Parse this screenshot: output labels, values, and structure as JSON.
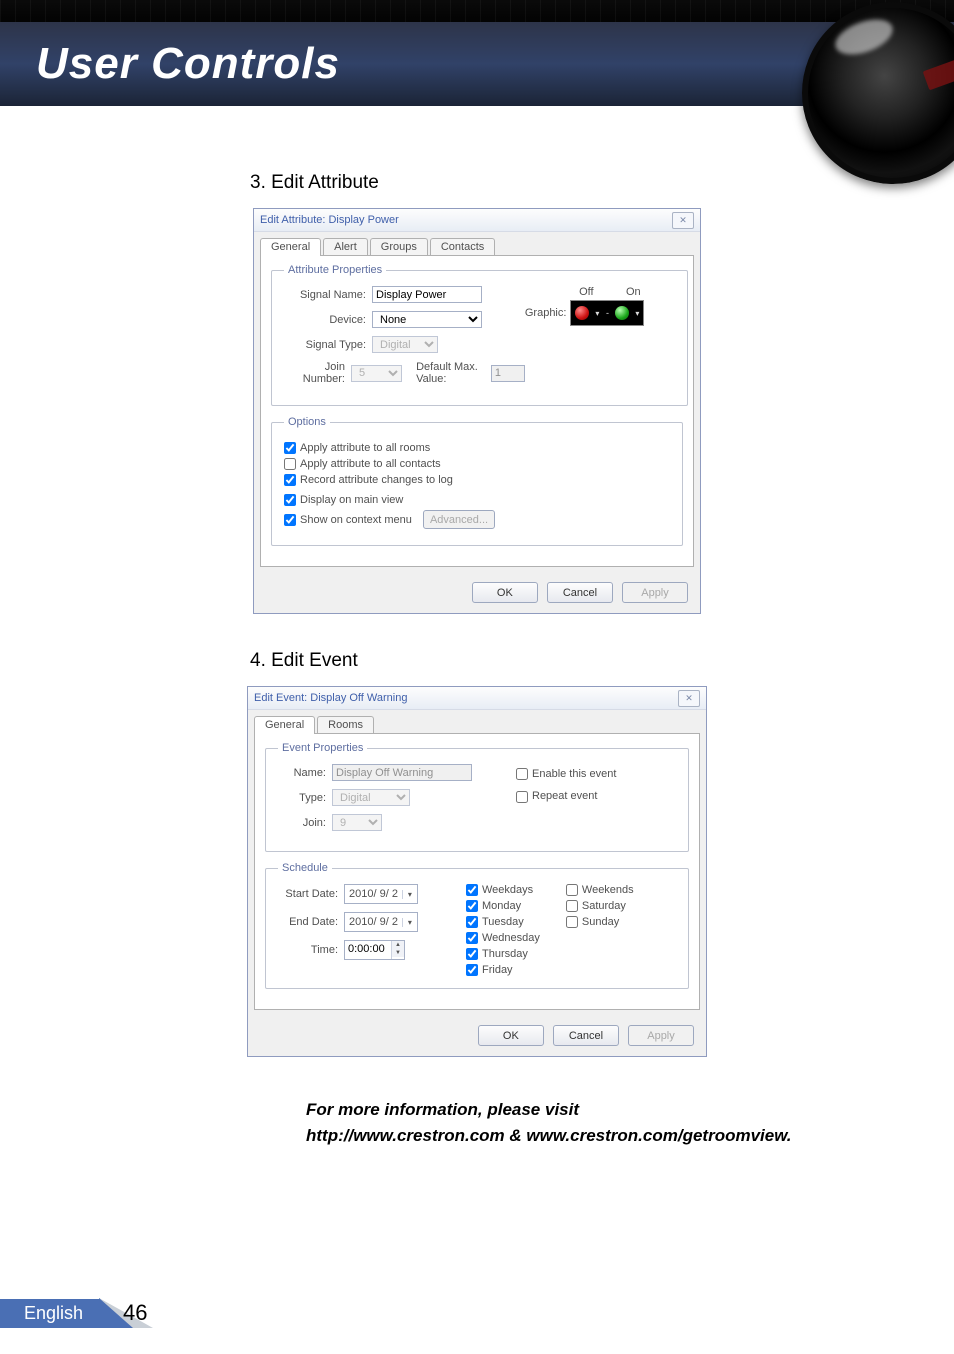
{
  "page": {
    "title": "User Controls",
    "step3": "3.   Edit Attribute",
    "step4": "4.   Edit Event",
    "info_line1": "For more information, please visit",
    "info_line2": "http://www.crestron.com & www.crestron.com/getroomview.",
    "footer_lang": "English",
    "footer_page": "46"
  },
  "dialog1": {
    "title": "Edit Attribute: Display Power",
    "tabs": [
      "General",
      "Alert",
      "Groups",
      "Contacts"
    ],
    "fs_props": "Attribute Properties",
    "signal_name_label": "Signal Name:",
    "signal_name_value": "Display Power",
    "device_label": "Device:",
    "device_value": "None",
    "signal_type_label": "Signal Type:",
    "signal_type_value": "Digital",
    "join_label": "Join Number:",
    "join_value": "5",
    "default_max_label": "Default Max. Value:",
    "default_max_value": "1",
    "graphic_label": "Graphic:",
    "graphic_off": "Off",
    "graphic_on": "On",
    "fs_options": "Options",
    "opt_all_rooms": "Apply attribute to all rooms",
    "opt_all_contacts": "Apply attribute to all contacts",
    "opt_record_log": "Record attribute changes to log",
    "opt_main_view": "Display on main view",
    "opt_context_menu": "Show on context menu",
    "advanced_btn": "Advanced...",
    "ok": "OK",
    "cancel": "Cancel",
    "apply": "Apply"
  },
  "dialog2": {
    "title": "Edit Event: Display Off Warning",
    "tabs": [
      "General",
      "Rooms"
    ],
    "fs_props": "Event Properties",
    "name_label": "Name:",
    "name_value": "Display Off Warning",
    "type_label": "Type:",
    "type_value": "Digital",
    "join_label": "Join:",
    "join_value": "9",
    "enable_event": "Enable this event",
    "repeat_event": "Repeat event",
    "fs_schedule": "Schedule",
    "start_date_label": "Start Date:",
    "start_date_value": "2010/ 9/ 2",
    "end_date_label": "End Date:",
    "end_date_value": "2010/ 9/ 2",
    "time_label": "Time:",
    "time_value": "0:00:00",
    "weekdays": "Weekdays",
    "monday": "Monday",
    "tuesday": "Tuesday",
    "wednesday": "Wednesday",
    "thursday": "Thursday",
    "friday": "Friday",
    "weekends": "Weekends",
    "saturday": "Saturday",
    "sunday": "Sunday",
    "ok": "OK",
    "cancel": "Cancel",
    "apply": "Apply"
  }
}
